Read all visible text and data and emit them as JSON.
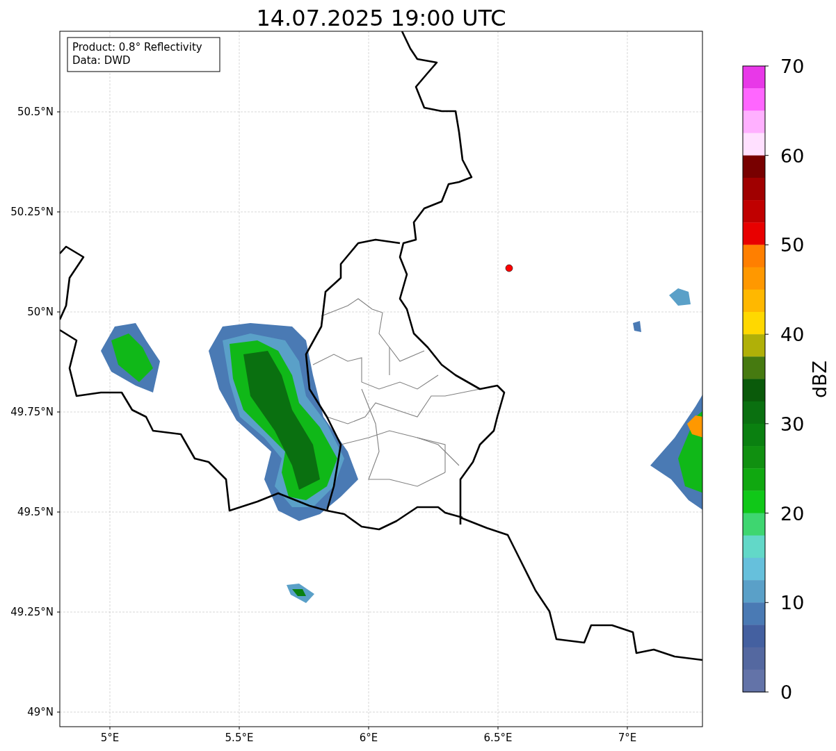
{
  "title": "14.07.2025 19:00 UTC",
  "info_box": [
    "Product: 0.8° Reflectivity",
    "Data: DWD"
  ],
  "map": {
    "x_ticks": [
      "5°E",
      "5.5°E",
      "6°E",
      "6.5°E",
      "7°E"
    ],
    "y_ticks": [
      "50.5°N",
      "50.25°N",
      "50°N",
      "49.75°N",
      "49.5°N",
      "49.25°N",
      "49°N"
    ]
  },
  "colorbar": {
    "label": "dBZ",
    "ticks": [
      "70",
      "60",
      "50",
      "40",
      "30",
      "20",
      "10",
      "0"
    ],
    "bands": [
      {
        "color": "#e838e8"
      },
      {
        "color": "#ff66ff"
      },
      {
        "color": "#ffb0ff"
      },
      {
        "color": "#ffe0ff"
      },
      {
        "color": "#780000"
      },
      {
        "color": "#a00000"
      },
      {
        "color": "#c00000"
      },
      {
        "color": "#e80000"
      },
      {
        "color": "#ff7f00"
      },
      {
        "color": "#ff9800"
      },
      {
        "color": "#ffb800"
      },
      {
        "color": "#ffd800"
      },
      {
        "color": "#b0b008"
      },
      {
        "color": "#467a10"
      },
      {
        "color": "#0a5a0a"
      },
      {
        "color": "#0a7010"
      },
      {
        "color": "#0a8010"
      },
      {
        "color": "#109010"
      },
      {
        "color": "#10a810"
      },
      {
        "color": "#10c818"
      },
      {
        "color": "#3ed670"
      },
      {
        "color": "#62d8c8"
      },
      {
        "color": "#66c0dc"
      },
      {
        "color": "#5aa0c8"
      },
      {
        "color": "#4a7ab4"
      },
      {
        "color": "#4460a0"
      },
      {
        "color": "#5468a0"
      },
      {
        "color": "#6373a8"
      }
    ]
  }
}
